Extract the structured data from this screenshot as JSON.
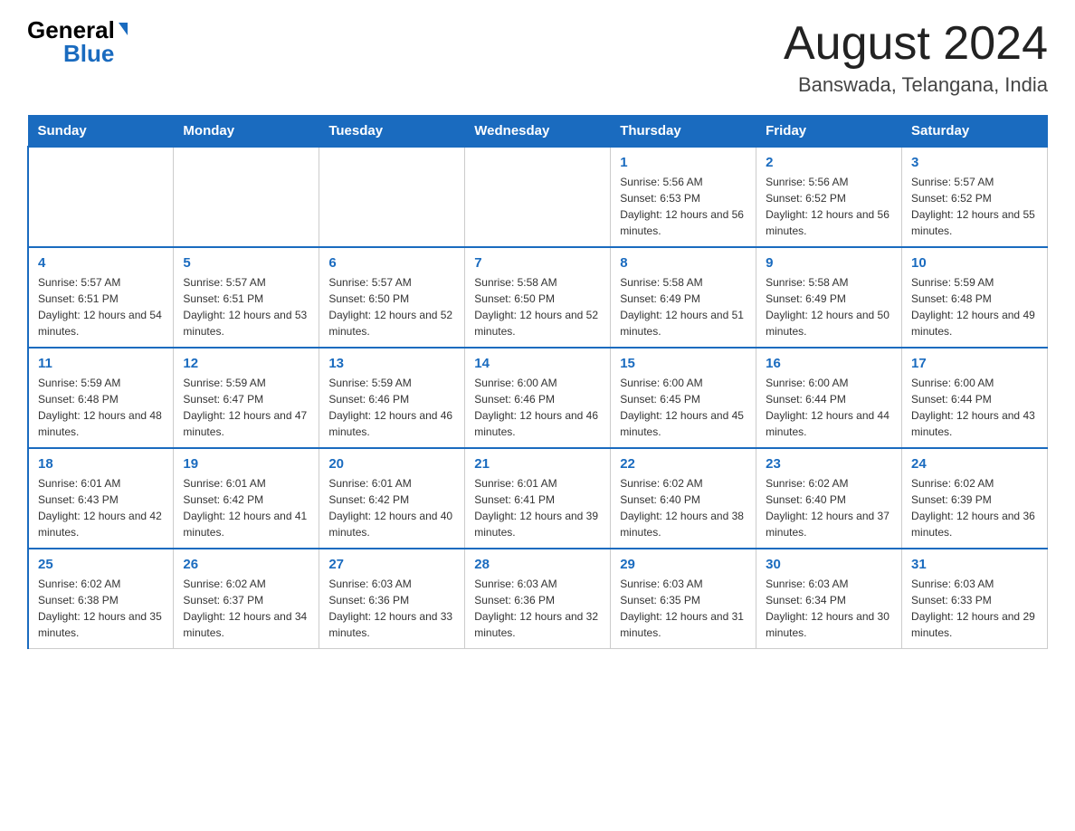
{
  "header": {
    "logo_general": "General",
    "logo_blue": "Blue",
    "month_title": "August 2024",
    "location": "Banswada, Telangana, India"
  },
  "days_of_week": [
    "Sunday",
    "Monday",
    "Tuesday",
    "Wednesday",
    "Thursday",
    "Friday",
    "Saturday"
  ],
  "weeks": [
    [
      {
        "day": "",
        "info": ""
      },
      {
        "day": "",
        "info": ""
      },
      {
        "day": "",
        "info": ""
      },
      {
        "day": "",
        "info": ""
      },
      {
        "day": "1",
        "info": "Sunrise: 5:56 AM\nSunset: 6:53 PM\nDaylight: 12 hours and 56 minutes."
      },
      {
        "day": "2",
        "info": "Sunrise: 5:56 AM\nSunset: 6:52 PM\nDaylight: 12 hours and 56 minutes."
      },
      {
        "day": "3",
        "info": "Sunrise: 5:57 AM\nSunset: 6:52 PM\nDaylight: 12 hours and 55 minutes."
      }
    ],
    [
      {
        "day": "4",
        "info": "Sunrise: 5:57 AM\nSunset: 6:51 PM\nDaylight: 12 hours and 54 minutes."
      },
      {
        "day": "5",
        "info": "Sunrise: 5:57 AM\nSunset: 6:51 PM\nDaylight: 12 hours and 53 minutes."
      },
      {
        "day": "6",
        "info": "Sunrise: 5:57 AM\nSunset: 6:50 PM\nDaylight: 12 hours and 52 minutes."
      },
      {
        "day": "7",
        "info": "Sunrise: 5:58 AM\nSunset: 6:50 PM\nDaylight: 12 hours and 52 minutes."
      },
      {
        "day": "8",
        "info": "Sunrise: 5:58 AM\nSunset: 6:49 PM\nDaylight: 12 hours and 51 minutes."
      },
      {
        "day": "9",
        "info": "Sunrise: 5:58 AM\nSunset: 6:49 PM\nDaylight: 12 hours and 50 minutes."
      },
      {
        "day": "10",
        "info": "Sunrise: 5:59 AM\nSunset: 6:48 PM\nDaylight: 12 hours and 49 minutes."
      }
    ],
    [
      {
        "day": "11",
        "info": "Sunrise: 5:59 AM\nSunset: 6:48 PM\nDaylight: 12 hours and 48 minutes."
      },
      {
        "day": "12",
        "info": "Sunrise: 5:59 AM\nSunset: 6:47 PM\nDaylight: 12 hours and 47 minutes."
      },
      {
        "day": "13",
        "info": "Sunrise: 5:59 AM\nSunset: 6:46 PM\nDaylight: 12 hours and 46 minutes."
      },
      {
        "day": "14",
        "info": "Sunrise: 6:00 AM\nSunset: 6:46 PM\nDaylight: 12 hours and 46 minutes."
      },
      {
        "day": "15",
        "info": "Sunrise: 6:00 AM\nSunset: 6:45 PM\nDaylight: 12 hours and 45 minutes."
      },
      {
        "day": "16",
        "info": "Sunrise: 6:00 AM\nSunset: 6:44 PM\nDaylight: 12 hours and 44 minutes."
      },
      {
        "day": "17",
        "info": "Sunrise: 6:00 AM\nSunset: 6:44 PM\nDaylight: 12 hours and 43 minutes."
      }
    ],
    [
      {
        "day": "18",
        "info": "Sunrise: 6:01 AM\nSunset: 6:43 PM\nDaylight: 12 hours and 42 minutes."
      },
      {
        "day": "19",
        "info": "Sunrise: 6:01 AM\nSunset: 6:42 PM\nDaylight: 12 hours and 41 minutes."
      },
      {
        "day": "20",
        "info": "Sunrise: 6:01 AM\nSunset: 6:42 PM\nDaylight: 12 hours and 40 minutes."
      },
      {
        "day": "21",
        "info": "Sunrise: 6:01 AM\nSunset: 6:41 PM\nDaylight: 12 hours and 39 minutes."
      },
      {
        "day": "22",
        "info": "Sunrise: 6:02 AM\nSunset: 6:40 PM\nDaylight: 12 hours and 38 minutes."
      },
      {
        "day": "23",
        "info": "Sunrise: 6:02 AM\nSunset: 6:40 PM\nDaylight: 12 hours and 37 minutes."
      },
      {
        "day": "24",
        "info": "Sunrise: 6:02 AM\nSunset: 6:39 PM\nDaylight: 12 hours and 36 minutes."
      }
    ],
    [
      {
        "day": "25",
        "info": "Sunrise: 6:02 AM\nSunset: 6:38 PM\nDaylight: 12 hours and 35 minutes."
      },
      {
        "day": "26",
        "info": "Sunrise: 6:02 AM\nSunset: 6:37 PM\nDaylight: 12 hours and 34 minutes."
      },
      {
        "day": "27",
        "info": "Sunrise: 6:03 AM\nSunset: 6:36 PM\nDaylight: 12 hours and 33 minutes."
      },
      {
        "day": "28",
        "info": "Sunrise: 6:03 AM\nSunset: 6:36 PM\nDaylight: 12 hours and 32 minutes."
      },
      {
        "day": "29",
        "info": "Sunrise: 6:03 AM\nSunset: 6:35 PM\nDaylight: 12 hours and 31 minutes."
      },
      {
        "day": "30",
        "info": "Sunrise: 6:03 AM\nSunset: 6:34 PM\nDaylight: 12 hours and 30 minutes."
      },
      {
        "day": "31",
        "info": "Sunrise: 6:03 AM\nSunset: 6:33 PM\nDaylight: 12 hours and 29 minutes."
      }
    ]
  ]
}
